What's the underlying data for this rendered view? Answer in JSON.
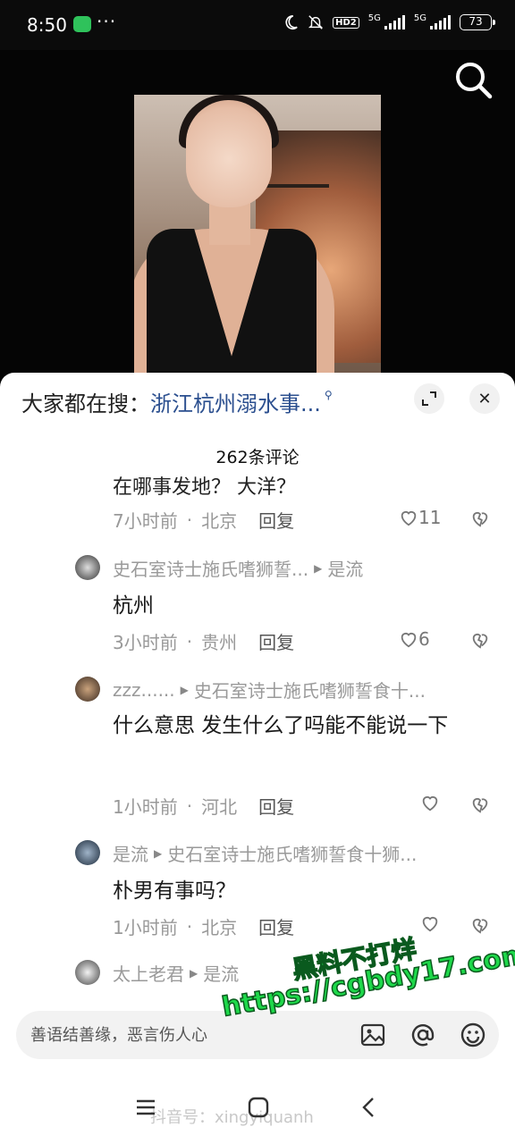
{
  "status_bar": {
    "time": "8:50",
    "dots": "···",
    "hd": "HD2",
    "net1": "5G",
    "net2": "5G",
    "battery": "73"
  },
  "hot_search": {
    "label": "大家都在搜：",
    "term": "浙江杭州溺水事..."
  },
  "comment_count": "262条评论",
  "partial_comment": {
    "text": "在哪事发地？ 大洋？",
    "time": "7小时前",
    "location": "北京",
    "reply": "回复",
    "likes": "11"
  },
  "comments": [
    {
      "author": "史石室诗士施氏嗜狮誓...",
      "reply_to": "是流",
      "text": "杭州",
      "time": "3小时前",
      "location": "贵州",
      "reply": "回复",
      "likes": "6"
    },
    {
      "author": "zzz......",
      "reply_to": "史石室诗士施氏嗜狮誓食十...",
      "text": "什么意思 发生什么了吗能不能说一下",
      "time": "1小时前",
      "location": "河北",
      "reply": "回复",
      "likes": ""
    },
    {
      "author": "是流",
      "reply_to": "史石室诗士施氏嗜狮誓食十狮...",
      "text": "朴男有事吗？",
      "time": "1小时前",
      "location": "北京",
      "reply": "回复",
      "likes": ""
    },
    {
      "author": "太上老君",
      "reply_to": "是流",
      "text": "",
      "time": "",
      "location": "",
      "reply": "",
      "likes": ""
    }
  ],
  "input": {
    "placeholder": "善语结善缘，恶言伤人心"
  },
  "watermark": {
    "line1": "黑料不打烊",
    "line2": "https://cgbdy17.com"
  },
  "credit": "抖音号：xingyiquanh",
  "colors": {
    "accent_link": "#2b4f8f",
    "watermark": "#1ed84a"
  }
}
